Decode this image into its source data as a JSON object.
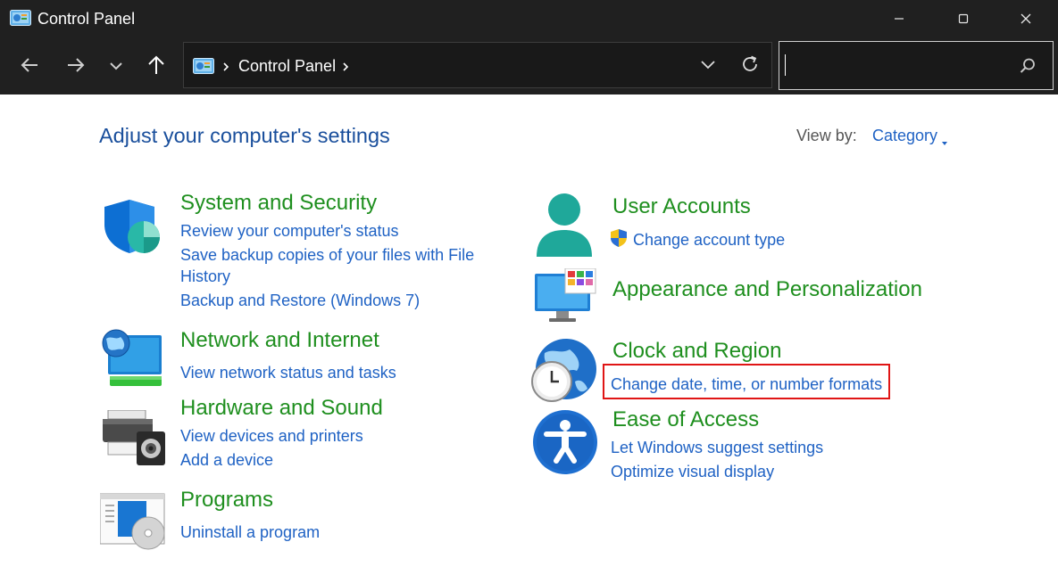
{
  "window": {
    "title": "Control Panel",
    "controls": {
      "minimize_icon": "minimize-icon",
      "maximize_icon": "maximize-icon",
      "close_icon": "close-icon"
    }
  },
  "navigation": {
    "back_icon": "arrow-left-icon",
    "forward_icon": "arrow-right-icon",
    "recent_icon": "chevron-down-icon",
    "up_icon": "arrow-up-icon",
    "address": {
      "icon": "control-panel-icon",
      "breadcrumb": [
        "Control Panel"
      ]
    },
    "refresh_icon": "refresh-icon",
    "search": {
      "value": "",
      "placeholder": "",
      "icon": "search-icon"
    }
  },
  "main": {
    "heading": "Adjust your computer's settings",
    "view_by": {
      "label": "View by:",
      "value": "Category"
    },
    "categories": [
      {
        "title": "System and Security",
        "icon": "shield-icon",
        "links": [
          "Review your computer's status",
          "Save backup copies of your files with File",
          "History",
          "Backup and Restore (Windows 7)"
        ]
      },
      {
        "title": "Network and Internet",
        "icon": "network-globe-icon",
        "links": [
          "View network status and tasks"
        ]
      },
      {
        "title": "Hardware and Sound",
        "icon": "printer-speaker-icon",
        "links": [
          "View devices and printers",
          "Add a device"
        ]
      },
      {
        "title": "Programs",
        "icon": "programs-disc-icon",
        "links": [
          "Uninstall a program"
        ]
      },
      {
        "title": "User Accounts",
        "icon": "user-icon",
        "links": [
          "Change account type"
        ],
        "link_icon": "uac-shield-icon"
      },
      {
        "title": "Appearance and Personalization",
        "icon": "monitor-palette-icon",
        "links": []
      },
      {
        "title": "Clock and Region",
        "icon": "clock-globe-icon",
        "links": [
          "Change date, time, or number formats"
        ],
        "highlighted_link": "Change date, time, or number formats"
      },
      {
        "title": "Ease of Access",
        "icon": "accessibility-icon",
        "links": [
          "Let Windows suggest settings",
          "Optimize visual display"
        ]
      }
    ]
  },
  "colors": {
    "titlebar_bg": "#202020",
    "heading": "#1a4f9c",
    "category_title": "#1f8f1f",
    "link": "#1f62c4",
    "highlight_border": "#e01515"
  }
}
